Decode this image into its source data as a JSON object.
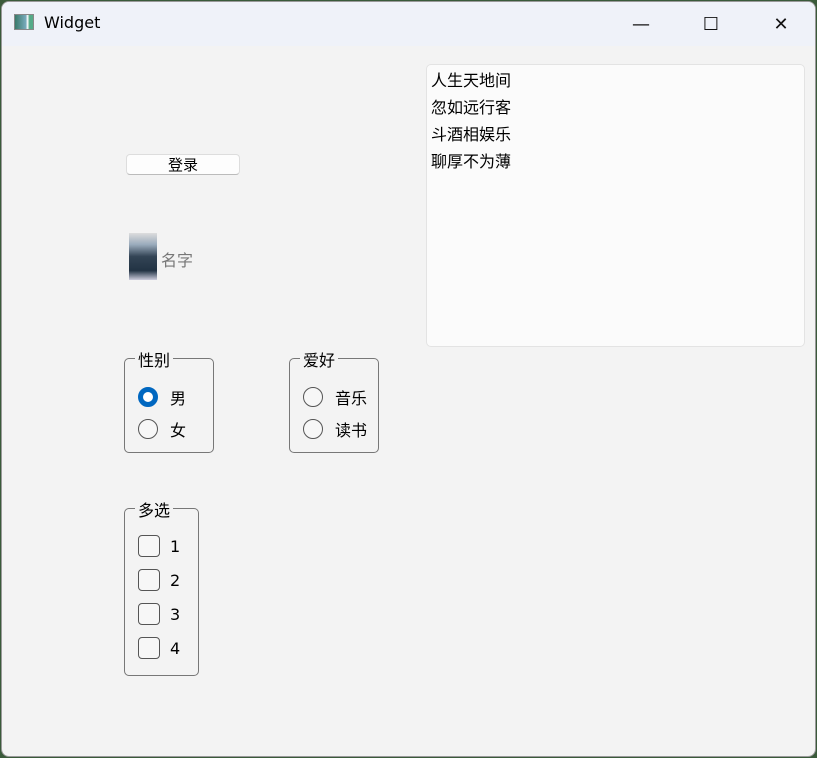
{
  "window": {
    "title": "Widget",
    "minimize": "—",
    "maximize": "☐",
    "close": "✕"
  },
  "login_button": "登录",
  "avatar_label": "名字",
  "gender": {
    "title": "性别",
    "options": [
      "男",
      "女"
    ],
    "selected": 0
  },
  "hobby": {
    "title": "爱好",
    "options": [
      "音乐",
      "读书"
    ]
  },
  "multi": {
    "title": "多选",
    "options": [
      "1",
      "2",
      "3",
      "4"
    ]
  },
  "textarea": {
    "lines": [
      "人生天地间",
      "忽如远行客",
      "斗酒相娱乐",
      "聊厚不为薄"
    ]
  }
}
